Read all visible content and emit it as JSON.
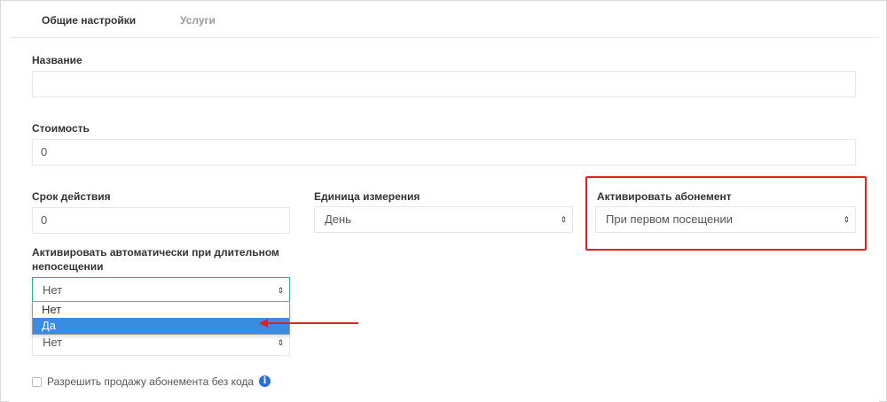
{
  "tabs": [
    {
      "label": "Общие настройки",
      "active": true
    },
    {
      "label": "Услуги",
      "active": false
    }
  ],
  "form": {
    "name": {
      "label": "Название",
      "value": ""
    },
    "cost": {
      "label": "Стоимость",
      "value": "0"
    },
    "duration": {
      "label": "Срок действия",
      "value": "0"
    },
    "unit": {
      "label": "Единица измерения",
      "value": "День"
    },
    "activate": {
      "label": "Активировать абонемент",
      "value": "При первом посещении"
    },
    "auto_activate": {
      "label_line1": "Активировать автоматически при длительном",
      "label_line2": "непосещении",
      "value": "Нет",
      "options": [
        "Нет",
        "Да"
      ],
      "highlighted_option": "Да"
    },
    "hidden_select": {
      "value": "Нет"
    },
    "allow_sale": {
      "label": "Разрешить продажу абонемента без кода",
      "checked": false
    }
  },
  "icons": {
    "info": "info-icon",
    "select_arrows": "sort-arrows-icon"
  },
  "colors": {
    "accent_focus": "#1ab394",
    "annotation_red": "#e02020",
    "option_selected": "#3a8ce3",
    "info_blue": "#2a6fd6"
  }
}
